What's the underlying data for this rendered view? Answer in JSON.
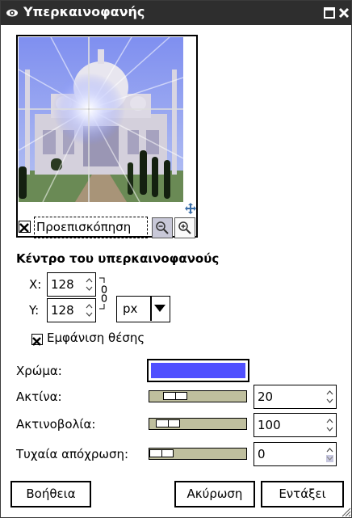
{
  "window": {
    "title": "Υπερκαινοφανής",
    "icons": [
      "eye-icon",
      "maximize-icon",
      "close-icon"
    ]
  },
  "preview": {
    "label": "Προεπισκόπηση",
    "checked": true,
    "icons": [
      "move-icon",
      "zoom-out-icon",
      "zoom-in-icon"
    ]
  },
  "center": {
    "title": "Κέντρο του υπερκαινοφανούς",
    "x_label": "X:",
    "x_value": "128",
    "y_label": "Y:",
    "y_value": "128",
    "unit": "px",
    "show_position_label": "Εμφάνιση θέσης",
    "show_position_checked": true
  },
  "params": {
    "color_label": "Χρώμα:",
    "color_value": "#5050ff",
    "radius_label": "Ακτίνα:",
    "radius_value": "20",
    "spokes_label": "Ακτινοβολία:",
    "spokes_value": "100",
    "hue_label": "Τυχαία απόχρωση:",
    "hue_value": "0"
  },
  "buttons": {
    "help": "Βοήθεια",
    "cancel": "Ακύρωση",
    "ok": "Εντάξει"
  }
}
